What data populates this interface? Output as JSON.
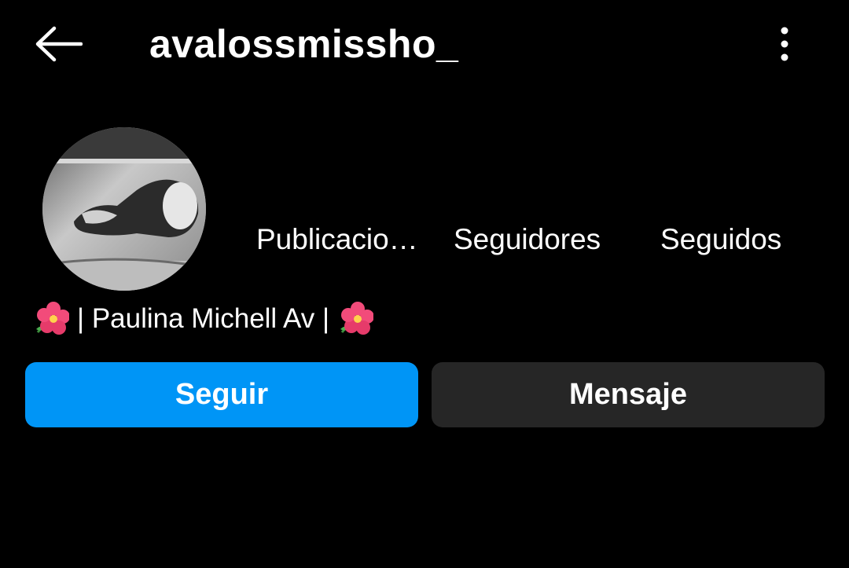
{
  "header": {
    "username": "avalossmissho_",
    "back_icon": "arrow-left-icon",
    "more_icon": "vertical-dots-icon"
  },
  "profile": {
    "avatar_icon": "profile-photo",
    "stats": {
      "posts_label": "Publicaciones",
      "followers_label": "Seguidores",
      "following_label": "Seguidos"
    },
    "bio": {
      "name_text": "| Paulina Michell Av |",
      "emoji_icon": "hibiscus-icon"
    }
  },
  "actions": {
    "follow_label": "Seguir",
    "message_label": "Mensaje"
  },
  "colors": {
    "background": "#000000",
    "text": "#ffffff",
    "follow_button": "#0095f6",
    "message_button": "#262626"
  }
}
